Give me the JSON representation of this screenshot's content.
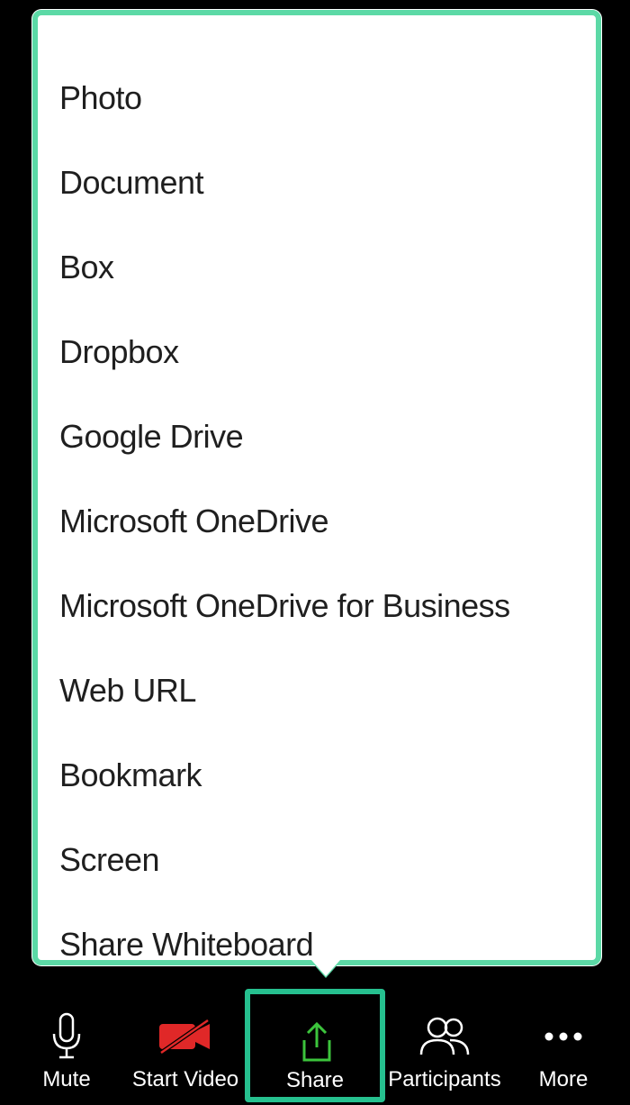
{
  "share_menu": {
    "items": [
      "Photo",
      "Document",
      "Box",
      "Dropbox",
      "Google Drive",
      "Microsoft OneDrive",
      "Microsoft OneDrive for Business",
      "Web URL",
      "Bookmark",
      "Screen",
      "Share Whiteboard"
    ]
  },
  "toolbar": {
    "mute": "Mute",
    "start_video": "Start Video",
    "share": "Share",
    "participants": "Participants",
    "more": "More"
  }
}
